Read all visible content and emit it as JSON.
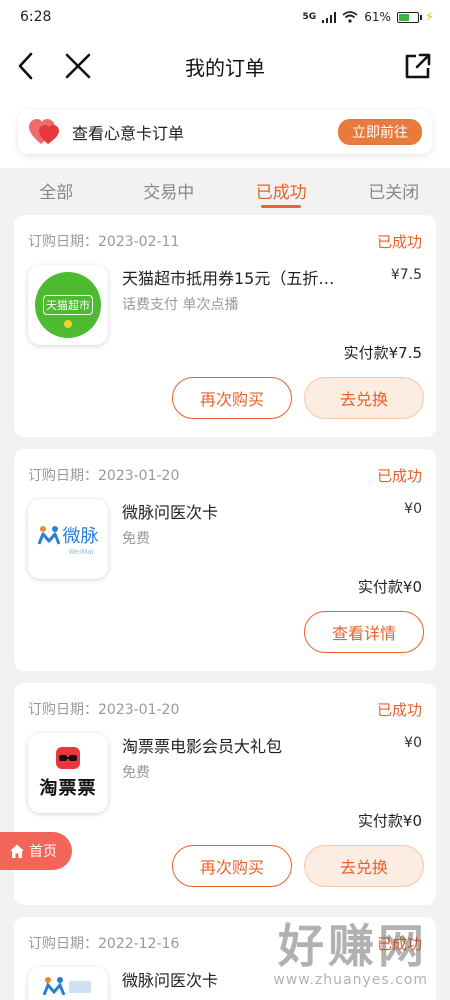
{
  "statusbar": {
    "time": "6:28",
    "network": "5G",
    "battery": "61%",
    "battery_level": 0.61
  },
  "header": {
    "title": "我的订单"
  },
  "banner": {
    "text": "查看心意卡订单",
    "button": "立即前往"
  },
  "tabs": [
    {
      "label": "全部",
      "active": false
    },
    {
      "label": "交易中",
      "active": false
    },
    {
      "label": "已成功",
      "active": true
    },
    {
      "label": "已关闭",
      "active": false
    }
  ],
  "orders": [
    {
      "date": "订购日期：2023-02-11",
      "status": "已成功",
      "name": "天猫超市抵用券15元（五折…",
      "price": "¥7.5",
      "sub": "话费支付 单次点播",
      "paid": "实付款¥7.5",
      "icon": "tmall-supermarket-logo",
      "icon_text": "天猫超市",
      "buttons": [
        "再次购买",
        "去兑换"
      ]
    },
    {
      "date": "订购日期：2023-01-20",
      "status": "已成功",
      "name": "微脉问医次卡",
      "price": "¥0",
      "sub": "免费",
      "paid": "实付款¥0",
      "icon": "weimai-logo",
      "icon_text": "微脉",
      "icon_subtext": "WeiMai",
      "buttons": [
        "查看详情"
      ]
    },
    {
      "date": "订购日期：2023-01-20",
      "status": "已成功",
      "name": "淘票票电影会员大礼包",
      "price": "¥0",
      "sub": "免费",
      "paid": "实付款¥0",
      "icon": "taopiaopiao-logo",
      "icon_text": "淘票票",
      "buttons": [
        "再次购买",
        "去兑换"
      ]
    },
    {
      "date": "订购日期：2022-12-16",
      "status": "已成功",
      "name": "微脉问医次卡",
      "icon": "weimai-logo"
    }
  ],
  "home_button": {
    "label": "首页"
  },
  "watermark": {
    "big": "好赚网",
    "small": "www.zhuanyes.com"
  },
  "colors": {
    "accent": "#e8622a",
    "banner_button": "#e87a3c",
    "tmall_green": "#4cbb2f",
    "fab": "#f2665a"
  }
}
